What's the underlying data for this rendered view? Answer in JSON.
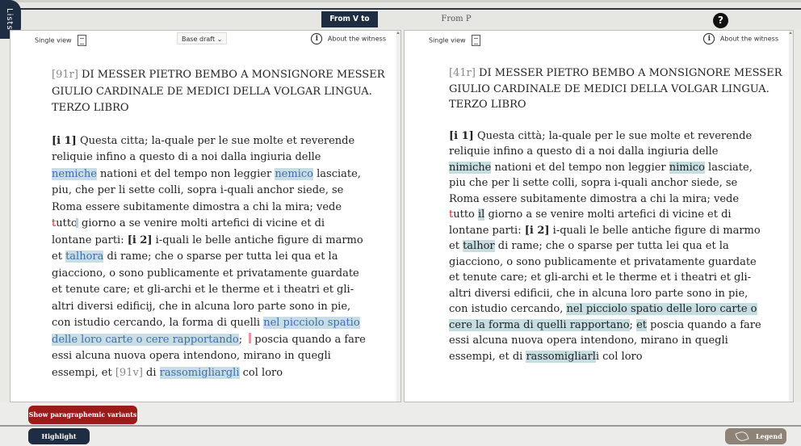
{
  "lists_tab": "Lists",
  "mode": {
    "active": "From V to P",
    "other": "From P to T"
  },
  "help": "?",
  "left": {
    "single_view": "Single view",
    "dropdown": "Base draft ⌄",
    "about": "About the witness",
    "title_pg": "[91r]",
    "title_lines": [
      " DI MESSER PIETRO BEMBO A MONSIGNORE MESSER",
      "GIULIO CARDINALE DE MEDICI DELLA VOLGAR LINGUA.",
      "TERZO LIBRO"
    ]
  },
  "right": {
    "single_view": "Single view",
    "about": "About the witness",
    "title_pg": "[41r]",
    "title_lines": [
      " DI MESSER PIETRO BEMBO A MONSIGNORE MESSER",
      "GIULIO CARDINALE DE MEDICI DELLA VOLGAR LINGUA.",
      "TERZO LIBRO"
    ]
  },
  "buttons": {
    "para": "Show paragraphemic variants",
    "entities": "Highlight Entities",
    "legend": "Legend"
  },
  "colors": {
    "dark_navy": "#1e2d42",
    "para_red": "#9b1a1a",
    "highlight": "#c9dde4",
    "legend": "#8d8477"
  }
}
